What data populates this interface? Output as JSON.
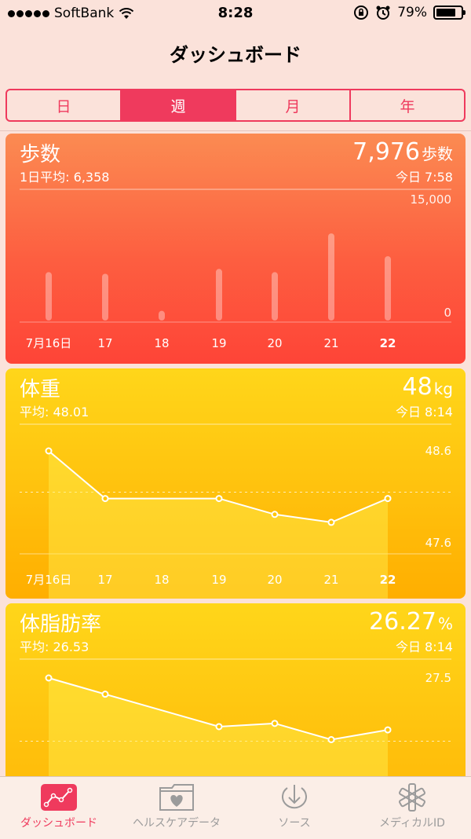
{
  "status_bar": {
    "carrier": "SoftBank",
    "time": "8:28",
    "battery": "79%",
    "battery_level": 0.79
  },
  "nav": {
    "title": "ダッシュボード"
  },
  "segments": [
    {
      "label": "日",
      "active": false
    },
    {
      "label": "週",
      "active": true
    },
    {
      "label": "月",
      "active": false
    },
    {
      "label": "年",
      "active": false
    }
  ],
  "cards": {
    "steps": {
      "title": "歩数",
      "average": "1日平均: 6,358",
      "value": "7,976",
      "unit": "歩数",
      "time": "今日 7:58",
      "ymax_label": "15,000",
      "ymin_label": "0"
    },
    "weight": {
      "title": "体重",
      "average": "平均: 48.01",
      "value": "48",
      "unit": "kg",
      "time": "今日 8:14",
      "ymax_label": "48.6",
      "ymin_label": "47.6"
    },
    "fat": {
      "title": "体脂肪率",
      "average": "平均: 26.53",
      "value": "26.27",
      "unit": "%",
      "time": "今日 8:14",
      "ymax_label": "27.5"
    }
  },
  "chart_data": [
    {
      "type": "bar",
      "title": "歩数",
      "categories": [
        "7月16日",
        "17",
        "18",
        "19",
        "20",
        "21",
        "22"
      ],
      "values": [
        6000,
        5800,
        1200,
        6400,
        6000,
        10800,
        7976
      ],
      "ylim": [
        0,
        15000
      ]
    },
    {
      "type": "line",
      "title": "体重",
      "categories": [
        "7月16日",
        "17",
        "18",
        "19",
        "20",
        "21",
        "22"
      ],
      "values": [
        48.6,
        48.0,
        null,
        48.0,
        47.8,
        47.7,
        48.0
      ],
      "ylim": [
        47.6,
        48.6
      ]
    },
    {
      "type": "line",
      "title": "体脂肪率",
      "categories": [
        "7月16日",
        "17",
        "18",
        "19",
        "20",
        "21",
        "22"
      ],
      "values": [
        27.5,
        27.25,
        null,
        26.75,
        26.8,
        26.55,
        26.7
      ],
      "ylim": [
        25.6,
        27.5
      ]
    }
  ],
  "tabs": [
    {
      "label": "ダッシュボード",
      "icon": "dashboard-icon",
      "active": true
    },
    {
      "label": "ヘルスケアデータ",
      "icon": "health-data-icon",
      "active": false
    },
    {
      "label": "ソース",
      "icon": "sources-icon",
      "active": false
    },
    {
      "label": "メディカルID",
      "icon": "medical-id-icon",
      "active": false
    }
  ]
}
